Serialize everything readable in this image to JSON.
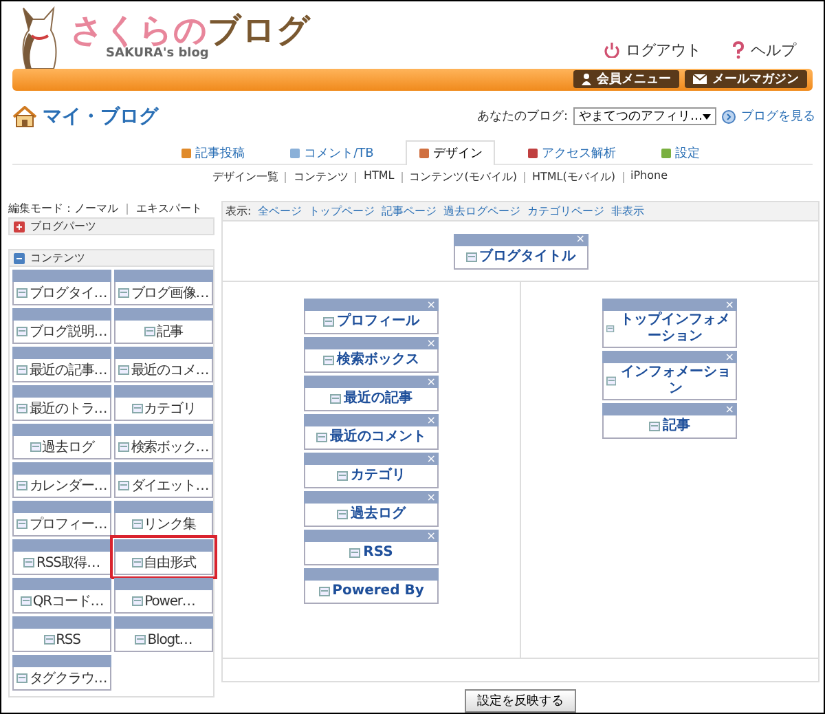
{
  "logo": {
    "title": [
      "さくら",
      "の",
      "ブログ"
    ],
    "subtitle": "SAKURA's blog"
  },
  "header_links": [
    {
      "label": "ログアウト"
    },
    {
      "label": "ヘルプ"
    }
  ],
  "header_buttons": [
    "会員メニュー",
    "メールマガジン"
  ],
  "page_title": "マイ・ブログ",
  "blog_selector": {
    "label": "あなたのブログ:",
    "value": "やまてつのアフィリ…",
    "view_link": "ブログを見る"
  },
  "tabs": [
    {
      "label": "記事投稿",
      "selected": false
    },
    {
      "label": "コメント/TB",
      "selected": false
    },
    {
      "label": "デザイン",
      "selected": true
    },
    {
      "label": "アクセス解析",
      "selected": false
    },
    {
      "label": "設定",
      "selected": false
    }
  ],
  "subnav": [
    "デザイン一覧",
    "コンテンツ",
    "HTML",
    "コンテンツ(モバイル)",
    "HTML(モバイル)",
    "iPhone"
  ],
  "edit_mode": {
    "label": "編集モード：ノーマル",
    "link": "エキスパート"
  },
  "sections": [
    {
      "title": "ブログパーツ",
      "expanded": false
    },
    {
      "title": "コンテンツ",
      "expanded": true
    }
  ],
  "palette": [
    {
      "label": "ブログタイ…",
      "highlighted": false
    },
    {
      "label": "ブログ画像…",
      "highlighted": false
    },
    {
      "label": "ブログ説明…",
      "highlighted": false
    },
    {
      "label": "記事",
      "highlighted": false
    },
    {
      "label": "最近の記事…",
      "highlighted": false
    },
    {
      "label": "最近のコメ…",
      "highlighted": false
    },
    {
      "label": "最近のトラ…",
      "highlighted": false
    },
    {
      "label": "カテゴリ",
      "highlighted": false
    },
    {
      "label": "過去ログ",
      "highlighted": false
    },
    {
      "label": "検索ボック…",
      "highlighted": false
    },
    {
      "label": "カレンダー…",
      "highlighted": false
    },
    {
      "label": "ダイエット…",
      "highlighted": false
    },
    {
      "label": "プロフィー…",
      "highlighted": false
    },
    {
      "label": "リンク集",
      "highlighted": false
    },
    {
      "label": "RSS取得…",
      "highlighted": false
    },
    {
      "label": "自由形式",
      "highlighted": true
    },
    {
      "label": "QRコード…",
      "highlighted": false
    },
    {
      "label": "Power…",
      "highlighted": false
    },
    {
      "label": "RSS",
      "highlighted": false
    },
    {
      "label": "Blogt…",
      "highlighted": false
    },
    {
      "label": "タグクラウ…",
      "highlighted": false
    }
  ],
  "display_filter": {
    "label": "表示:",
    "links": [
      "全ページ",
      "トップページ",
      "記事ページ",
      "過去ログページ",
      "カテゴリページ",
      "非表示"
    ]
  },
  "layout": {
    "top": [
      {
        "label": "ブログタイトル",
        "closable": true
      }
    ],
    "left": [
      {
        "label": "プロフィール",
        "closable": true
      },
      {
        "label": "検索ボックス",
        "closable": true
      },
      {
        "label": "最近の記事",
        "closable": true
      },
      {
        "label": "最近のコメント",
        "closable": true
      },
      {
        "label": "カテゴリ",
        "closable": true
      },
      {
        "label": "過去ログ",
        "closable": true
      },
      {
        "label": "RSS",
        "closable": true
      },
      {
        "label": "Powered By",
        "closable": false
      }
    ],
    "right": [
      {
        "label": "トップインフォメーション",
        "closable": true
      },
      {
        "label": "インフォメーション",
        "closable": true
      },
      {
        "label": "記事",
        "closable": true
      }
    ]
  },
  "close_glyph": "×",
  "apply_button": "設定を反映する"
}
